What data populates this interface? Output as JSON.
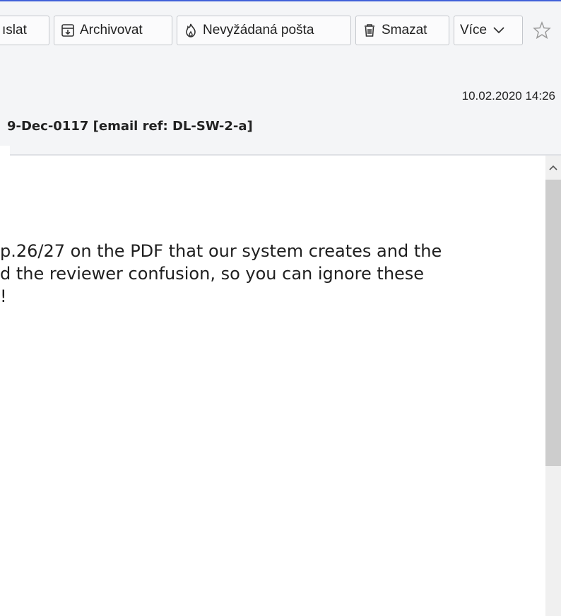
{
  "toolbar": {
    "buttons": [
      {
        "label": "ıslat",
        "icon": "none"
      },
      {
        "label": "Archivovat",
        "icon": "archive-icon"
      },
      {
        "label": "Nevyžádaná pošta",
        "icon": "junk-icon"
      },
      {
        "label": "Smazat",
        "icon": "trash-icon"
      },
      {
        "label": "Více",
        "icon": "chevron-down-icon"
      }
    ],
    "star_icon": "star-icon"
  },
  "message": {
    "date": "10.02.2020 14:26",
    "subject": "9-Dec-0117 [email ref: DL-SW-2-a]",
    "body_lines": [
      "p.26/27 on the PDF that our system creates and the",
      "d the reviewer confusion, so you can ignore these",
      "!"
    ]
  },
  "colors": {
    "accent_line": "#4060d8",
    "header_bg": "#f4f5f7",
    "scroll_thumb": "#cdcdcd"
  }
}
